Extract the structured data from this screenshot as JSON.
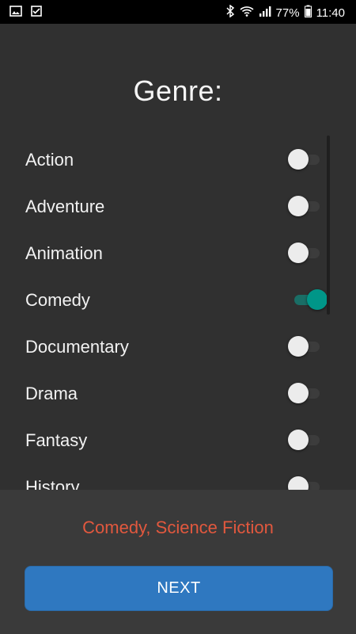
{
  "status_bar": {
    "left_icons": [
      "image-icon",
      "checklist-icon"
    ],
    "right_icons": [
      "bluetooth-icon",
      "wifi-icon",
      "signal-icon"
    ],
    "battery": "77%",
    "time": "11:40"
  },
  "screen": {
    "title": "Genre:",
    "genres": [
      {
        "label": "Action",
        "on": false
      },
      {
        "label": "Adventure",
        "on": false
      },
      {
        "label": "Animation",
        "on": false
      },
      {
        "label": "Comedy",
        "on": true
      },
      {
        "label": "Documentary",
        "on": false
      },
      {
        "label": "Drama",
        "on": false
      },
      {
        "label": "Fantasy",
        "on": false
      },
      {
        "label": "History",
        "on": false
      }
    ]
  },
  "footer": {
    "selected_text": "Comedy, Science Fiction",
    "next_label": "NEXT"
  },
  "colors": {
    "accent_on": "#009688",
    "selection_text": "#e2583e",
    "button": "#2f78c0"
  }
}
